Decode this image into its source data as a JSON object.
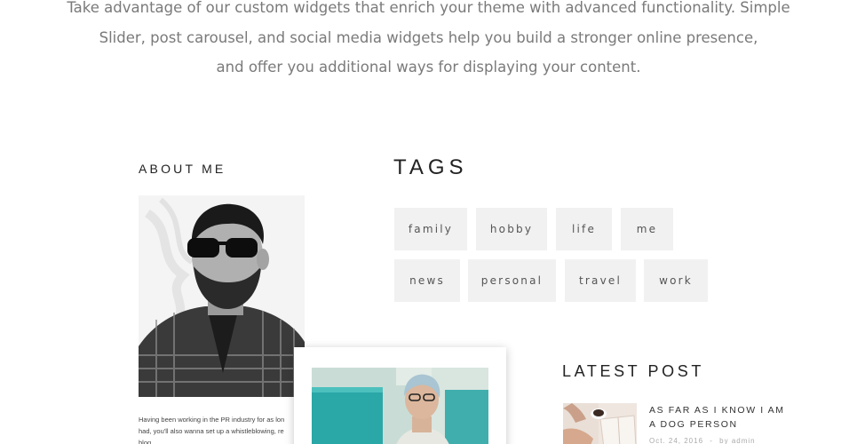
{
  "intro": {
    "line1": "Take advantage of our custom widgets that enrich your theme with advanced functionality. Simple",
    "line2": "Slider, post carousel, and social media widgets help you build a stronger online presence,",
    "line3": "and offer you additional ways for displaying your content."
  },
  "about": {
    "title": "ABOUT ME",
    "text_line1": "Having been working in the PR industry for as lon",
    "text_line2": "had, you'll also wanna set up a whistleblowing, re",
    "text_line3": "blog"
  },
  "tags": {
    "title": "TAGS",
    "items": [
      "family",
      "hobby",
      "life",
      "me",
      "news",
      "personal",
      "travel",
      "work"
    ]
  },
  "latest": {
    "title": "LATEST POST",
    "post_title": "AS FAR AS I KNOW I AM A DOG PERSON",
    "post_date": "Oct. 24, 2016",
    "post_sep": "-",
    "post_author": "by admin"
  },
  "colors": {
    "tag_bg": "#f1f1f1",
    "intro_text": "#7a7a7a",
    "heading": "#222222"
  }
}
